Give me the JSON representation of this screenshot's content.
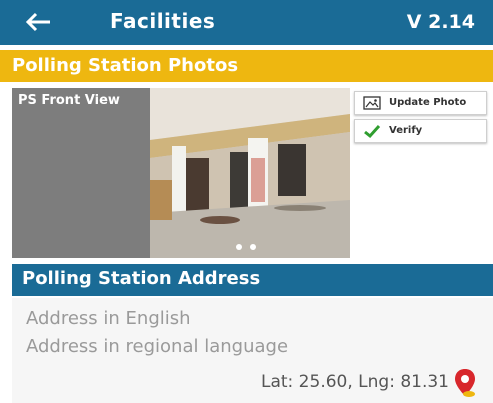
{
  "header": {
    "title": "Facilities",
    "version": "V 2.14"
  },
  "photos_section": {
    "title": "Polling Station Photos",
    "photo_label": "PS Front View",
    "carousel_dots": 2
  },
  "actions": {
    "update_label": "Update Photo",
    "verify_label": "Verify"
  },
  "address_section": {
    "title": "Polling Station Address",
    "english_placeholder": "Address in English",
    "regional_placeholder": "Address in regional language",
    "coords": "Lat: 25.60, Lng: 81.31"
  },
  "colors": {
    "primary": "#1a6b96",
    "accent": "#eeb710",
    "verify_check": "#2f9e2f",
    "pin": "#d8272c"
  },
  "icons": {
    "back": "back-arrow-icon",
    "update": "photo-icon",
    "verify": "checkmark-icon",
    "location": "location-pin-icon"
  }
}
